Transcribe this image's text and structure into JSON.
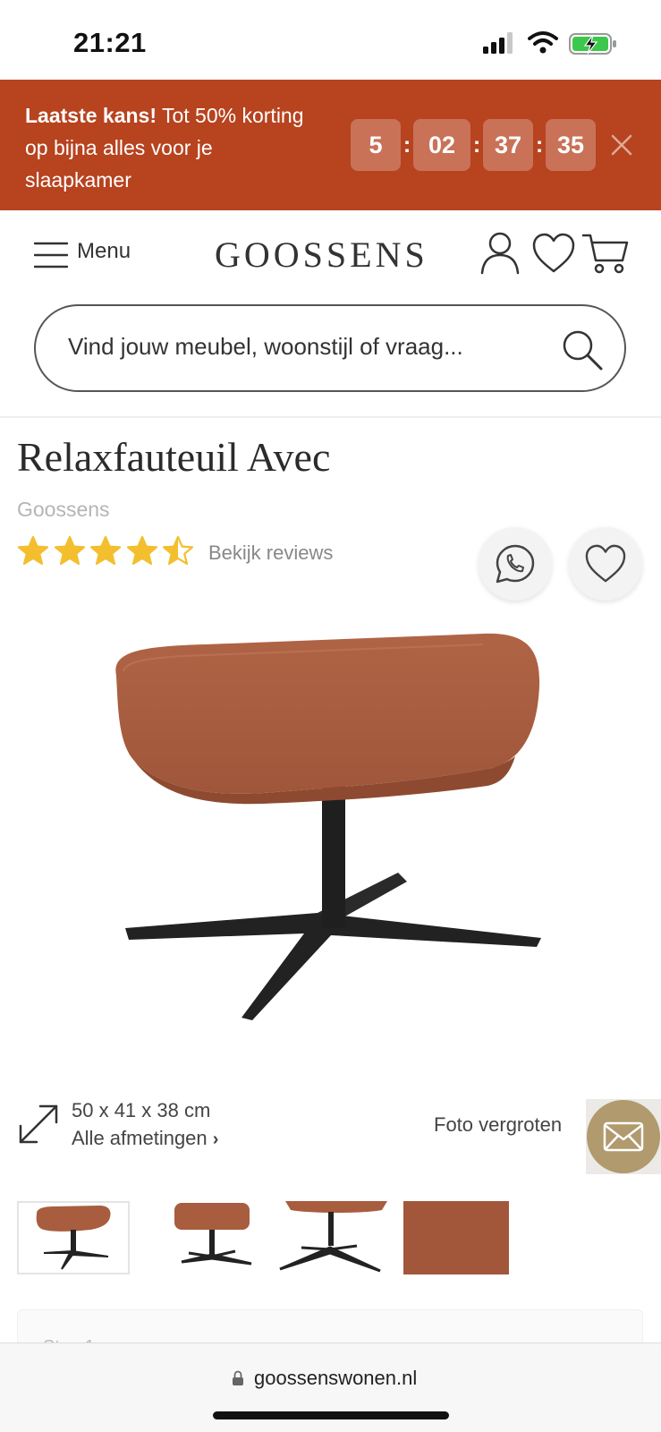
{
  "status_bar": {
    "time": "21:21"
  },
  "promo": {
    "highlight": "Laatste kans!",
    "text": " Tot 50% korting op bijna alles voor je slaapkamer",
    "countdown": {
      "days": "5",
      "hours": "02",
      "minutes": "37",
      "seconds": "35",
      "separator": ":"
    }
  },
  "header": {
    "menu_label": "Menu",
    "logo": "GOOSSENS"
  },
  "search": {
    "placeholder": "Vind jouw meubel, woonstijl of vraag..."
  },
  "product": {
    "title": "Relaxfauteuil Avec",
    "brand": "Goossens",
    "rating": 4.5,
    "rating_max": 5,
    "reviews_link": "Bekijk reviews",
    "dimensions": "50 x 41 x 38 cm",
    "dimensions_link": "Alle afmetingen",
    "photo_enlarge": "Foto vergroten"
  },
  "thumbnails": [
    "footstool-front",
    "footstool-side",
    "footstool-base",
    "fabric-detail"
  ],
  "card": {
    "label": "Stap 1"
  },
  "browser": {
    "url": "goossenswonen.nl"
  },
  "colors": {
    "promo_bg": "#b7431f",
    "star": "#f3bf2f",
    "leather": "#a85d3f",
    "mail_button": "#b09a6e"
  },
  "icons": {
    "account": "user-icon",
    "wishlist": "heart-icon",
    "cart": "cart-icon",
    "search": "search-icon",
    "whatsapp": "whatsapp-icon",
    "favorite": "heart-icon",
    "dimensions": "resize-arrows-icon",
    "mail": "envelope-icon",
    "lock": "lock-icon"
  }
}
